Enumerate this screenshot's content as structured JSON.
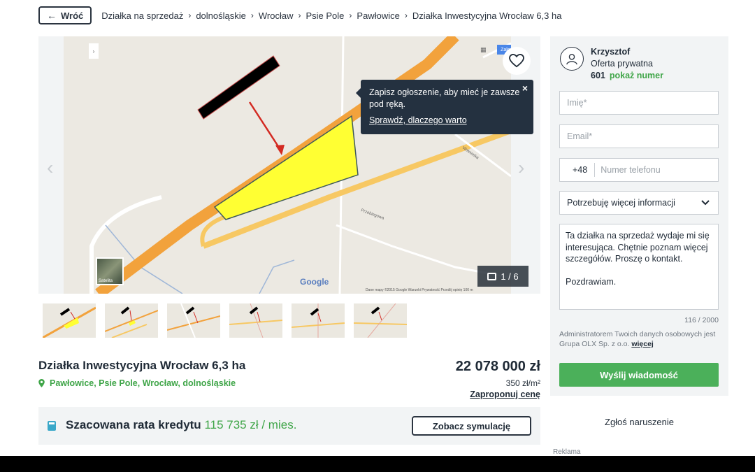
{
  "breadcrumb": {
    "back_label": "Wróć",
    "items": [
      "Działka na sprzedaż",
      "dolnośląskie",
      "Wrocław",
      "Psie Pole",
      "Pawłowice",
      "Działka Inwestycyjna Wrocław 6,3 ha"
    ]
  },
  "gallery": {
    "tooltip_text": "Zapisz ogłoszenie, aby mieć je zawsze pod ręką.",
    "tooltip_link": "Sprawdź, dlaczego warto",
    "counter": "1 / 6",
    "map_labels": {
      "google": "Google",
      "login": "Zaloguj się",
      "satellite": "Satelita",
      "footer": "Dane mapy ©2015 Google   Warunki   Prywatność   Prześlij opinię   100 m",
      "street1": "Przebiegowa",
      "street2": "Wołowska"
    },
    "thumbnail_count": 6
  },
  "listing": {
    "title": "Działka Inwestycyjna Wrocław 6,3 ha",
    "location": "Pawłowice, Psie Pole, Wrocław, dolnośląskie",
    "price": "22 078 000 zł",
    "price_per_sqm": "350 zł/m²",
    "propose_label": "Zaproponuj cenę"
  },
  "credit": {
    "label": "Szacowana rata kredytu",
    "value": "115 735 zł / mies.",
    "button": "Zobacz symulację"
  },
  "seller": {
    "name": "Krzysztof",
    "type": "Oferta prywatna",
    "phone_prefix": "601",
    "show_number": "pokaż numer"
  },
  "form": {
    "name_placeholder": "Imię*",
    "email_placeholder": "Email*",
    "phone_prefix": "+48",
    "phone_placeholder": "Numer telefonu",
    "select_value": "Potrzebuję więcej informacji",
    "message": "Ta działka na sprzedaż wydaje mi się interesująca. Chętnie poznam więcej szczegółów. Proszę o kontakt.\n\nPozdrawiam.",
    "char_count": "116 / 2000",
    "gdpr_text": "Administratorem Twoich danych osobowych jest Grupa OLX Sp. z o.o.",
    "gdpr_more": "więcej",
    "send_button": "Wyślij wiadomość"
  },
  "sidebar_footer": {
    "report": "Zgłoś naruszenie",
    "ad_label": "Reklama"
  },
  "colors": {
    "accent_green": "#3fa548",
    "button_green": "#4bb05a",
    "tooltip_bg": "#243140",
    "panel_bg": "#f2f4f5"
  }
}
